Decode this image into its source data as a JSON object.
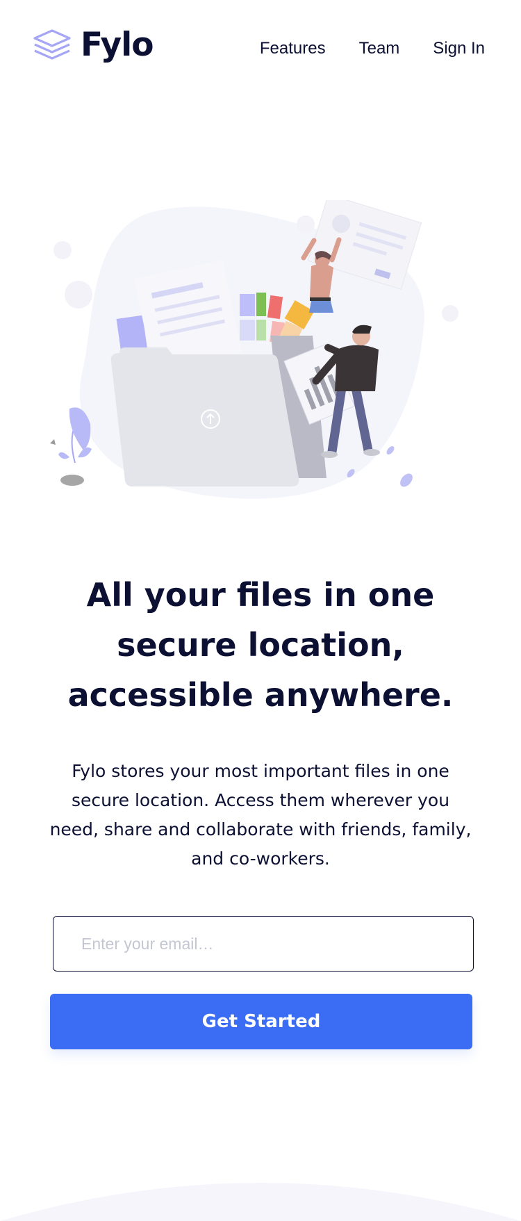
{
  "brand": {
    "name": "Fylo",
    "logo_icon": "stacked-layers-icon",
    "accent_color": "#3a6cf4",
    "text_color": "#0c1033",
    "logo_color": "#a5a6f6"
  },
  "nav": {
    "items": [
      {
        "label": "Features"
      },
      {
        "label": "Team"
      },
      {
        "label": "Sign In"
      }
    ]
  },
  "hero": {
    "illustration": "people-organizing-files-illustration",
    "headline": "All your files in one secure location, accessible anywhere.",
    "lead": "Fylo stores your most important files in one secure location. Access them wherever you need, share and collaborate with friends, family, and co-workers."
  },
  "form": {
    "email_placeholder": "Enter your email…",
    "email_value": "",
    "submit_label": "Get Started"
  }
}
